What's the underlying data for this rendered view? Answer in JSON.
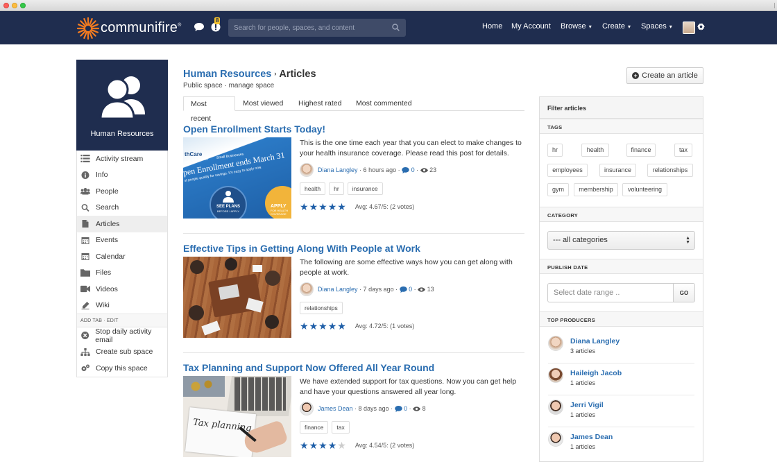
{
  "app": {
    "brand": "communifire",
    "brand_mark": "®",
    "notif_count": "8"
  },
  "search": {
    "placeholder": "Search for people, spaces, and content"
  },
  "nav": [
    {
      "label": "Home"
    },
    {
      "label": "My Account"
    },
    {
      "label": "Browse",
      "caret": "▾"
    },
    {
      "label": "Create",
      "caret": "▾"
    },
    {
      "label": "Spaces",
      "caret": "▾"
    }
  ],
  "space": {
    "name": "Human Resources",
    "subtitle": "Public space · manage space"
  },
  "sidebar": {
    "items": [
      {
        "label": "Activity stream",
        "icon": "list-icon"
      },
      {
        "label": "Info",
        "icon": "info-icon"
      },
      {
        "label": "People",
        "icon": "people-icon"
      },
      {
        "label": "Search",
        "icon": "search-icon"
      },
      {
        "label": "Articles",
        "icon": "document-icon",
        "active": true
      },
      {
        "label": "Events",
        "icon": "calendar-icon"
      },
      {
        "label": "Calendar",
        "icon": "calendar-icon"
      },
      {
        "label": "Files",
        "icon": "folder-icon"
      },
      {
        "label": "Videos",
        "icon": "video-icon"
      },
      {
        "label": "Wiki",
        "icon": "wiki-icon"
      }
    ],
    "meta": "ADD TAB · EDIT",
    "actions": [
      {
        "label": "Stop daily activity email",
        "icon": "close-circle-icon"
      },
      {
        "label": "Create sub space",
        "icon": "sitemap-icon"
      },
      {
        "label": "Copy this space",
        "icon": "gears-icon"
      }
    ]
  },
  "breadcrumb": {
    "space": "Human Resources",
    "sep": "›",
    "current": "Articles"
  },
  "tabs": [
    "Most recent",
    "Most viewed",
    "Highest rated",
    "Most commented"
  ],
  "create_button": "Create an article",
  "articles": [
    {
      "title": "Open Enrollment Starts Today!",
      "excerpt": "This is the one time each year that you can elect to make changes to your health insurance coverage. Please read this post for details.",
      "author": "Diana Langley",
      "time": "· 6 hours ago ·",
      "comments": "0",
      "views": "23",
      "tags": [
        "health",
        "hr",
        "insurance"
      ],
      "rating_stars": 5,
      "rating": "Avg: 4.67/5: (2 votes)",
      "thumb_text": {
        "brand": "thCare",
        "audience1": "uals & Families",
        "audience2": "Small Businesses",
        "headline": "pen Enrollment ends March 31",
        "sub": "st people qualify for savings. It's easy to apply now.",
        "cta": "SEE PLANS",
        "cta_sub": "BEFORE I APPLY",
        "apply": "APPLY",
        "apply_sub": "FOR HEALTH COVERAGE"
      }
    },
    {
      "title": "Effective Tips in Getting Along With People at Work",
      "excerpt": "The following are some effective ways how you can get along with people at work.",
      "author": "Diana Langley",
      "time": "· 7 days ago ·",
      "comments": "0",
      "views": "13",
      "tags": [
        "relationships"
      ],
      "rating_stars": 5,
      "rating": "Avg: 4.72/5: (1 votes)"
    },
    {
      "title": "Tax Planning and Support Now Offered All Year Round",
      "excerpt": "We have extended support for tax questions. Now you can get help and have your questions answered all year long.",
      "author": "James Dean",
      "time": "· 8 days ago ·",
      "comments": "0",
      "views": "8",
      "tags": [
        "finance",
        "tax"
      ],
      "rating_stars": 4,
      "rating": "Avg: 4.54/5: (2 votes)",
      "thumb_text": {
        "note": "Tax planning"
      }
    }
  ],
  "filter": {
    "title": "Filter articles",
    "tags_label": "TAGS",
    "tags": [
      "hr",
      "health",
      "finance",
      "tax",
      "employees",
      "insurance",
      "relationships",
      "gym",
      "membership",
      "volunteering"
    ],
    "category_label": "CATEGORY",
    "category_value": "--- all categories",
    "date_label": "PUBLISH DATE",
    "date_placeholder": "Select date range ..",
    "go": "GO",
    "producers_label": "TOP PRODUCERS",
    "producers": [
      {
        "name": "Diana Langley",
        "count": "3 articles"
      },
      {
        "name": "Haileigh Jacob",
        "count": "1 articles"
      },
      {
        "name": "Jerri Vigil",
        "count": "1 articles"
      },
      {
        "name": "James Dean",
        "count": "1 articles"
      }
    ]
  },
  "colors": {
    "navbar": "#1f2d4f",
    "link": "#2a6db0",
    "star": "#1f5fa8",
    "logo": "#f47b20"
  }
}
